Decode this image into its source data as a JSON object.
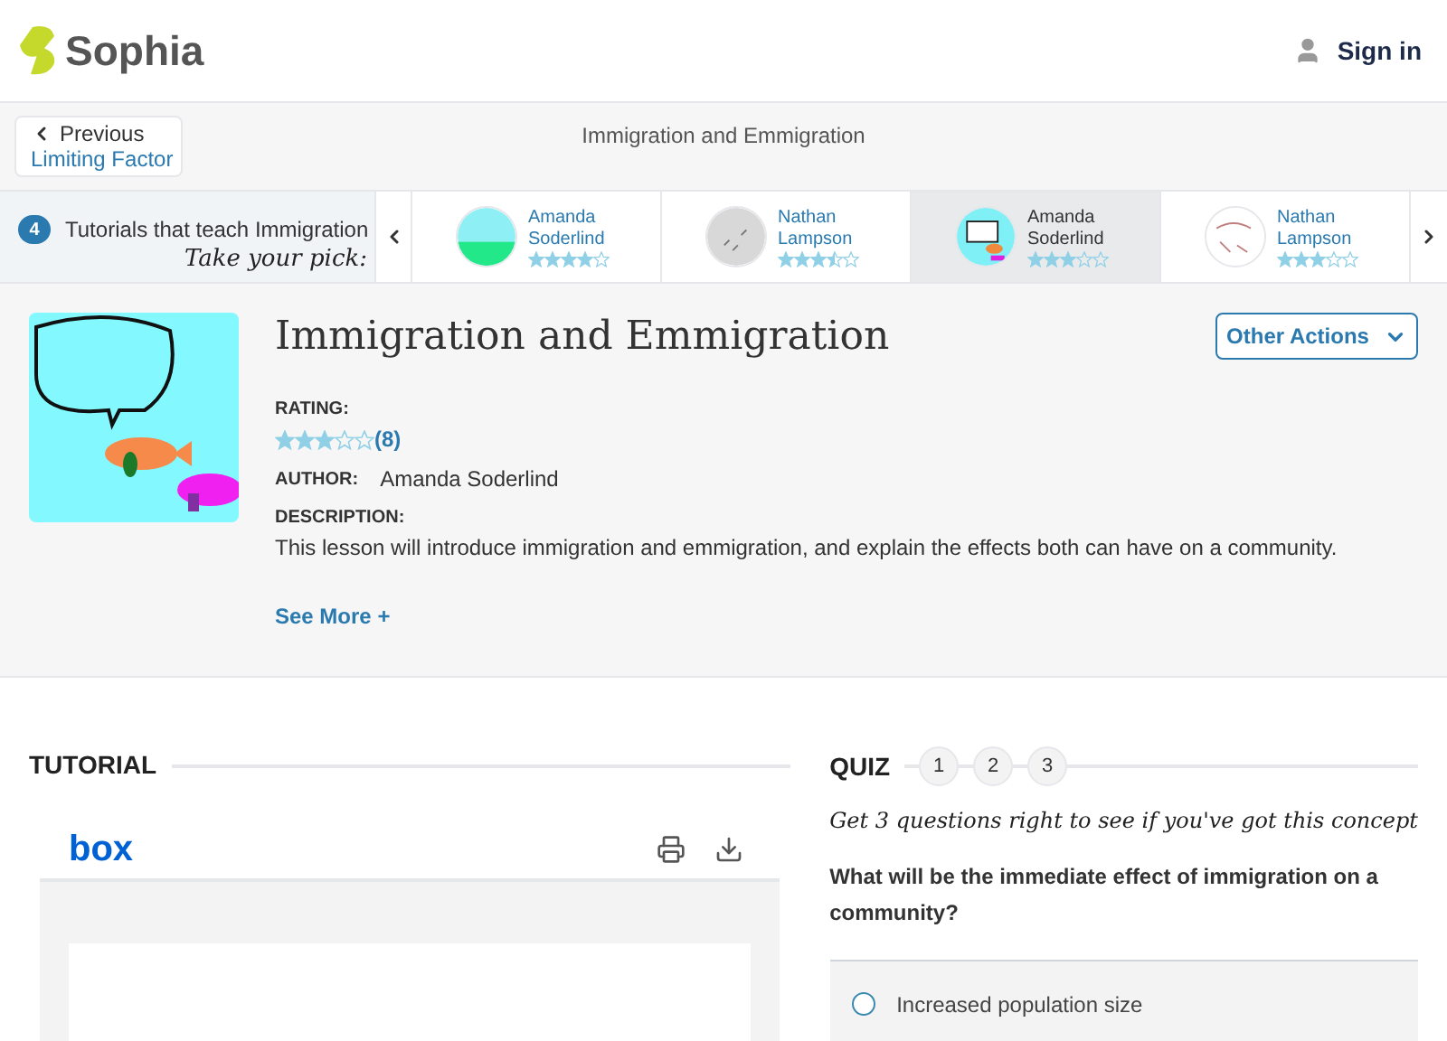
{
  "header": {
    "logo": "Sophia",
    "sign_in": "Sign in"
  },
  "nav": {
    "previous_label": "Previous",
    "previous_title": "Limiting Factor",
    "page_title": "Immigration and Emmigration"
  },
  "tutorials": {
    "count": "4",
    "label": "Tutorials that teach Immigration",
    "pick": "Take your pick:",
    "cards": [
      {
        "first": "Amanda",
        "last": "Soderlind",
        "stars": 4,
        "selected": false
      },
      {
        "first": "Nathan",
        "last": "Lampson",
        "stars": 3.5,
        "selected": false
      },
      {
        "first": "Amanda",
        "last": "Soderlind",
        "stars": 3,
        "selected": true
      },
      {
        "first": "Nathan",
        "last": "Lampson",
        "stars": 3,
        "selected": false
      }
    ]
  },
  "lesson": {
    "title": "Immigration and Emmigration",
    "actions": "Other Actions",
    "rating_label": "RATING:",
    "stars": 3,
    "rating_count": "(8)",
    "author_label": "AUTHOR:",
    "author": "Amanda Soderlind",
    "description_label": "DESCRIPTION:",
    "description": "This lesson will introduce immigration and emmigration, and explain the effects both can have on a community.",
    "see_more": "See More +"
  },
  "tutorial": {
    "heading": "TUTORIAL",
    "viewer_logo": "box"
  },
  "quiz": {
    "heading": "QUIZ",
    "steps": [
      "1",
      "2",
      "3"
    ],
    "hint": "Get 3 questions right to see if you've got this concept",
    "question": "What will be the immediate effect of immigration on a community?",
    "options": [
      {
        "label": "Increased population size",
        "selected": false
      }
    ]
  }
}
